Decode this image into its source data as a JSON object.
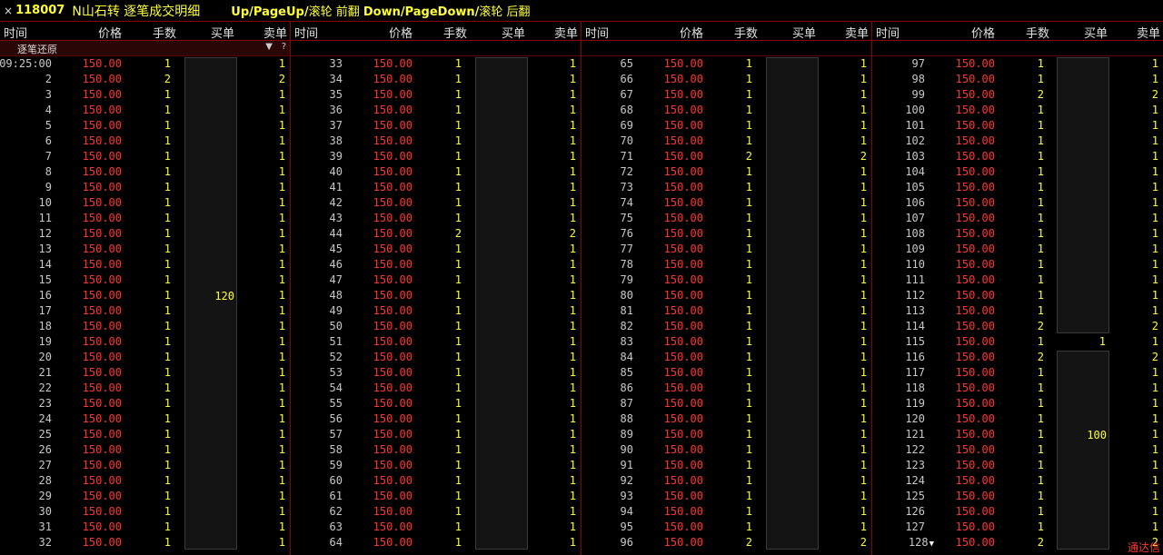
{
  "title": {
    "close": "×",
    "code": "118007",
    "name": "N山石转 逐笔成交明细",
    "hint_a": "Up/PageUp/",
    "hint_a_cn": "滚轮 前翻 ",
    "hint_b": "Down/PageDown/",
    "hint_b_cn": "滚轮 后翻"
  },
  "headers": {
    "time": "时间",
    "price": "价格",
    "volume": "手数",
    "buy": "买单",
    "sell": "卖单"
  },
  "subheader": {
    "tag": "逐笔还原",
    "filter_icon": "▼",
    "help_icon": "?"
  },
  "status": "通达信",
  "columns": [
    {
      "rows": [
        {
          "t": "09:25:00",
          "p": "150.00",
          "v": "1",
          "s": "1"
        },
        {
          "t": "2",
          "p": "150.00",
          "v": "2",
          "s": "2"
        },
        {
          "t": "3",
          "p": "150.00",
          "v": "1",
          "s": "1"
        },
        {
          "t": "4",
          "p": "150.00",
          "v": "1",
          "s": "1"
        },
        {
          "t": "5",
          "p": "150.00",
          "v": "1",
          "s": "1"
        },
        {
          "t": "6",
          "p": "150.00",
          "v": "1",
          "s": "1"
        },
        {
          "t": "7",
          "p": "150.00",
          "v": "1",
          "s": "1"
        },
        {
          "t": "8",
          "p": "150.00",
          "v": "1",
          "s": "1"
        },
        {
          "t": "9",
          "p": "150.00",
          "v": "1",
          "s": "1"
        },
        {
          "t": "10",
          "p": "150.00",
          "v": "1",
          "s": "1"
        },
        {
          "t": "11",
          "p": "150.00",
          "v": "1",
          "s": "1"
        },
        {
          "t": "12",
          "p": "150.00",
          "v": "1",
          "s": "1"
        },
        {
          "t": "13",
          "p": "150.00",
          "v": "1",
          "s": "1"
        },
        {
          "t": "14",
          "p": "150.00",
          "v": "1",
          "s": "1"
        },
        {
          "t": "15",
          "p": "150.00",
          "v": "1",
          "s": "1"
        },
        {
          "t": "16",
          "p": "150.00",
          "v": "1",
          "s": "1"
        },
        {
          "t": "17",
          "p": "150.00",
          "v": "1",
          "s": "1"
        },
        {
          "t": "18",
          "p": "150.00",
          "v": "1",
          "s": "1"
        },
        {
          "t": "19",
          "p": "150.00",
          "v": "1",
          "s": "1"
        },
        {
          "t": "20",
          "p": "150.00",
          "v": "1",
          "s": "1"
        },
        {
          "t": "21",
          "p": "150.00",
          "v": "1",
          "s": "1"
        },
        {
          "t": "22",
          "p": "150.00",
          "v": "1",
          "s": "1"
        },
        {
          "t": "23",
          "p": "150.00",
          "v": "1",
          "s": "1"
        },
        {
          "t": "24",
          "p": "150.00",
          "v": "1",
          "s": "1"
        },
        {
          "t": "25",
          "p": "150.00",
          "v": "1",
          "s": "1"
        },
        {
          "t": "26",
          "p": "150.00",
          "v": "1",
          "s": "1"
        },
        {
          "t": "27",
          "p": "150.00",
          "v": "1",
          "s": "1"
        },
        {
          "t": "28",
          "p": "150.00",
          "v": "1",
          "s": "1"
        },
        {
          "t": "29",
          "p": "150.00",
          "v": "1",
          "s": "1"
        },
        {
          "t": "30",
          "p": "150.00",
          "v": "1",
          "s": "1"
        },
        {
          "t": "31",
          "p": "150.00",
          "v": "1",
          "s": "1"
        },
        {
          "t": "32",
          "p": "150.00",
          "v": "1",
          "s": "1"
        }
      ],
      "buy_orders": [
        {
          "first": 0,
          "last": 31,
          "label": "120",
          "label_row": 15
        }
      ]
    },
    {
      "rows": [
        {
          "t": "33",
          "p": "150.00",
          "v": "1",
          "s": "1"
        },
        {
          "t": "34",
          "p": "150.00",
          "v": "1",
          "s": "1"
        },
        {
          "t": "35",
          "p": "150.00",
          "v": "1",
          "s": "1"
        },
        {
          "t": "36",
          "p": "150.00",
          "v": "1",
          "s": "1"
        },
        {
          "t": "37",
          "p": "150.00",
          "v": "1",
          "s": "1"
        },
        {
          "t": "38",
          "p": "150.00",
          "v": "1",
          "s": "1"
        },
        {
          "t": "39",
          "p": "150.00",
          "v": "1",
          "s": "1"
        },
        {
          "t": "40",
          "p": "150.00",
          "v": "1",
          "s": "1"
        },
        {
          "t": "41",
          "p": "150.00",
          "v": "1",
          "s": "1"
        },
        {
          "t": "42",
          "p": "150.00",
          "v": "1",
          "s": "1"
        },
        {
          "t": "43",
          "p": "150.00",
          "v": "1",
          "s": "1"
        },
        {
          "t": "44",
          "p": "150.00",
          "v": "2",
          "s": "2"
        },
        {
          "t": "45",
          "p": "150.00",
          "v": "1",
          "s": "1"
        },
        {
          "t": "46",
          "p": "150.00",
          "v": "1",
          "s": "1"
        },
        {
          "t": "47",
          "p": "150.00",
          "v": "1",
          "s": "1"
        },
        {
          "t": "48",
          "p": "150.00",
          "v": "1",
          "s": "1"
        },
        {
          "t": "49",
          "p": "150.00",
          "v": "1",
          "s": "1"
        },
        {
          "t": "50",
          "p": "150.00",
          "v": "1",
          "s": "1"
        },
        {
          "t": "51",
          "p": "150.00",
          "v": "1",
          "s": "1"
        },
        {
          "t": "52",
          "p": "150.00",
          "v": "1",
          "s": "1"
        },
        {
          "t": "53",
          "p": "150.00",
          "v": "1",
          "s": "1"
        },
        {
          "t": "54",
          "p": "150.00",
          "v": "1",
          "s": "1"
        },
        {
          "t": "55",
          "p": "150.00",
          "v": "1",
          "s": "1"
        },
        {
          "t": "56",
          "p": "150.00",
          "v": "1",
          "s": "1"
        },
        {
          "t": "57",
          "p": "150.00",
          "v": "1",
          "s": "1"
        },
        {
          "t": "58",
          "p": "150.00",
          "v": "1",
          "s": "1"
        },
        {
          "t": "59",
          "p": "150.00",
          "v": "1",
          "s": "1"
        },
        {
          "t": "60",
          "p": "150.00",
          "v": "1",
          "s": "1"
        },
        {
          "t": "61",
          "p": "150.00",
          "v": "1",
          "s": "1"
        },
        {
          "t": "62",
          "p": "150.00",
          "v": "1",
          "s": "1"
        },
        {
          "t": "63",
          "p": "150.00",
          "v": "1",
          "s": "1"
        },
        {
          "t": "64",
          "p": "150.00",
          "v": "1",
          "s": "1"
        }
      ],
      "buy_orders": [
        {
          "first": 0,
          "last": 31,
          "label": "",
          "label_row": 15
        }
      ]
    },
    {
      "rows": [
        {
          "t": "65",
          "p": "150.00",
          "v": "1",
          "s": "1"
        },
        {
          "t": "66",
          "p": "150.00",
          "v": "1",
          "s": "1"
        },
        {
          "t": "67",
          "p": "150.00",
          "v": "1",
          "s": "1"
        },
        {
          "t": "68",
          "p": "150.00",
          "v": "1",
          "s": "1"
        },
        {
          "t": "69",
          "p": "150.00",
          "v": "1",
          "s": "1"
        },
        {
          "t": "70",
          "p": "150.00",
          "v": "1",
          "s": "1"
        },
        {
          "t": "71",
          "p": "150.00",
          "v": "2",
          "s": "2"
        },
        {
          "t": "72",
          "p": "150.00",
          "v": "1",
          "s": "1"
        },
        {
          "t": "73",
          "p": "150.00",
          "v": "1",
          "s": "1"
        },
        {
          "t": "74",
          "p": "150.00",
          "v": "1",
          "s": "1"
        },
        {
          "t": "75",
          "p": "150.00",
          "v": "1",
          "s": "1"
        },
        {
          "t": "76",
          "p": "150.00",
          "v": "1",
          "s": "1"
        },
        {
          "t": "77",
          "p": "150.00",
          "v": "1",
          "s": "1"
        },
        {
          "t": "78",
          "p": "150.00",
          "v": "1",
          "s": "1"
        },
        {
          "t": "79",
          "p": "150.00",
          "v": "1",
          "s": "1"
        },
        {
          "t": "80",
          "p": "150.00",
          "v": "1",
          "s": "1"
        },
        {
          "t": "81",
          "p": "150.00",
          "v": "1",
          "s": "1"
        },
        {
          "t": "82",
          "p": "150.00",
          "v": "1",
          "s": "1"
        },
        {
          "t": "83",
          "p": "150.00",
          "v": "1",
          "s": "1"
        },
        {
          "t": "84",
          "p": "150.00",
          "v": "1",
          "s": "1"
        },
        {
          "t": "85",
          "p": "150.00",
          "v": "1",
          "s": "1"
        },
        {
          "t": "86",
          "p": "150.00",
          "v": "1",
          "s": "1"
        },
        {
          "t": "87",
          "p": "150.00",
          "v": "1",
          "s": "1"
        },
        {
          "t": "88",
          "p": "150.00",
          "v": "1",
          "s": "1"
        },
        {
          "t": "89",
          "p": "150.00",
          "v": "1",
          "s": "1"
        },
        {
          "t": "90",
          "p": "150.00",
          "v": "1",
          "s": "1"
        },
        {
          "t": "91",
          "p": "150.00",
          "v": "1",
          "s": "1"
        },
        {
          "t": "92",
          "p": "150.00",
          "v": "1",
          "s": "1"
        },
        {
          "t": "93",
          "p": "150.00",
          "v": "1",
          "s": "1"
        },
        {
          "t": "94",
          "p": "150.00",
          "v": "1",
          "s": "1"
        },
        {
          "t": "95",
          "p": "150.00",
          "v": "1",
          "s": "1"
        },
        {
          "t": "96",
          "p": "150.00",
          "v": "2",
          "s": "2"
        }
      ],
      "buy_orders": [
        {
          "first": 0,
          "last": 31,
          "label": "",
          "label_row": 15
        }
      ]
    },
    {
      "rows": [
        {
          "t": "97",
          "p": "150.00",
          "v": "1",
          "s": "1"
        },
        {
          "t": "98",
          "p": "150.00",
          "v": "1",
          "s": "1"
        },
        {
          "t": "99",
          "p": "150.00",
          "v": "2",
          "s": "2"
        },
        {
          "t": "100",
          "p": "150.00",
          "v": "1",
          "s": "1"
        },
        {
          "t": "101",
          "p": "150.00",
          "v": "1",
          "s": "1"
        },
        {
          "t": "102",
          "p": "150.00",
          "v": "1",
          "s": "1"
        },
        {
          "t": "103",
          "p": "150.00",
          "v": "1",
          "s": "1"
        },
        {
          "t": "104",
          "p": "150.00",
          "v": "1",
          "s": "1"
        },
        {
          "t": "105",
          "p": "150.00",
          "v": "1",
          "s": "1"
        },
        {
          "t": "106",
          "p": "150.00",
          "v": "1",
          "s": "1"
        },
        {
          "t": "107",
          "p": "150.00",
          "v": "1",
          "s": "1"
        },
        {
          "t": "108",
          "p": "150.00",
          "v": "1",
          "s": "1"
        },
        {
          "t": "109",
          "p": "150.00",
          "v": "1",
          "s": "1"
        },
        {
          "t": "110",
          "p": "150.00",
          "v": "1",
          "s": "1"
        },
        {
          "t": "111",
          "p": "150.00",
          "v": "1",
          "s": "1"
        },
        {
          "t": "112",
          "p": "150.00",
          "v": "1",
          "s": "1"
        },
        {
          "t": "113",
          "p": "150.00",
          "v": "1",
          "s": "1"
        },
        {
          "t": "114",
          "p": "150.00",
          "v": "2",
          "s": "2"
        },
        {
          "t": "115",
          "p": "150.00",
          "v": "1",
          "s": "1"
        },
        {
          "t": "116",
          "p": "150.00",
          "v": "2",
          "s": "2"
        },
        {
          "t": "117",
          "p": "150.00",
          "v": "1",
          "s": "1"
        },
        {
          "t": "118",
          "p": "150.00",
          "v": "1",
          "s": "1"
        },
        {
          "t": "119",
          "p": "150.00",
          "v": "1",
          "s": "1"
        },
        {
          "t": "120",
          "p": "150.00",
          "v": "1",
          "s": "1"
        },
        {
          "t": "121",
          "p": "150.00",
          "v": "1",
          "s": "1"
        },
        {
          "t": "122",
          "p": "150.00",
          "v": "1",
          "s": "1"
        },
        {
          "t": "123",
          "p": "150.00",
          "v": "1",
          "s": "1"
        },
        {
          "t": "124",
          "p": "150.00",
          "v": "1",
          "s": "1"
        },
        {
          "t": "125",
          "p": "150.00",
          "v": "1",
          "s": "1"
        },
        {
          "t": "126",
          "p": "150.00",
          "v": "1",
          "s": "1"
        },
        {
          "t": "127",
          "p": "150.00",
          "v": "1",
          "s": "1"
        },
        {
          "t": "128",
          "p": "150.00",
          "v": "2",
          "s": "2",
          "marker": "▼"
        }
      ],
      "buy_orders": [
        {
          "first": 0,
          "last": 17,
          "label": "",
          "label_row": 8
        },
        {
          "first": 18,
          "last": 18,
          "label": "1",
          "label_row": 18,
          "plain": true
        },
        {
          "first": 19,
          "last": 31,
          "label": "100",
          "label_row": 24
        }
      ]
    }
  ]
}
